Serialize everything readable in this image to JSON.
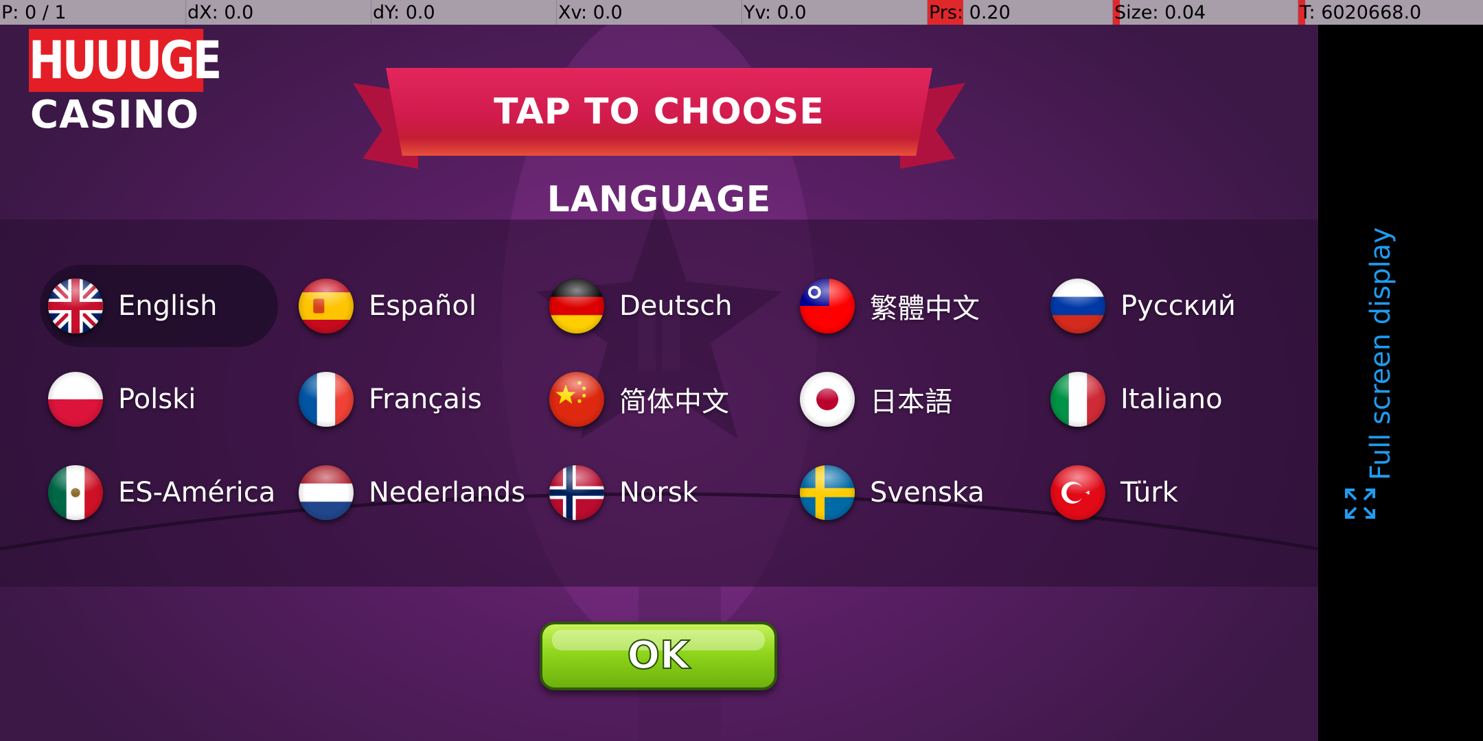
{
  "debug_bar": {
    "pointer": "P: 0 / 1",
    "dx": "dX: 0.0",
    "dy": "dY: 0.0",
    "xv": "Xv: 0.0",
    "yv": "Yv: 0.0",
    "prs": "Prs: 0.20",
    "size": "Size: 0.04",
    "time": "T: 6020668.0"
  },
  "logo": {
    "line1": "HUUUGE",
    "line2": "CASINO"
  },
  "banner_title": "TAP TO CHOOSE LANGUAGE",
  "languages": [
    {
      "label": "English",
      "flag": "uk-flag-icon",
      "selected": true
    },
    {
      "label": "Español",
      "flag": "spain-flag-icon"
    },
    {
      "label": "Deutsch",
      "flag": "germany-flag-icon"
    },
    {
      "label": "繁體中文",
      "flag": "taiwan-flag-icon"
    },
    {
      "label": "Русский",
      "flag": "russia-flag-icon"
    },
    {
      "label": "Polski",
      "flag": "poland-flag-icon"
    },
    {
      "label": "Français",
      "flag": "france-flag-icon"
    },
    {
      "label": "简体中文",
      "flag": "china-flag-icon"
    },
    {
      "label": "日本語",
      "flag": "japan-flag-icon"
    },
    {
      "label": "Italiano",
      "flag": "italy-flag-icon"
    },
    {
      "label": "ES-América",
      "flag": "mexico-flag-icon"
    },
    {
      "label": "Nederlands",
      "flag": "netherlands-flag-icon"
    },
    {
      "label": "Norsk",
      "flag": "norway-flag-icon"
    },
    {
      "label": "Svenska",
      "flag": "sweden-flag-icon"
    },
    {
      "label": "Türk",
      "flag": "turkey-flag-icon"
    }
  ],
  "ok_button": "OK",
  "fullscreen": {
    "label": "Full screen display",
    "icon": "expand-icon"
  },
  "colors": {
    "accent_blue": "#1e9cf0",
    "banner_red": "#d11b4d",
    "ok_green": "#8fd61c",
    "debug_red": "#e0282c"
  }
}
